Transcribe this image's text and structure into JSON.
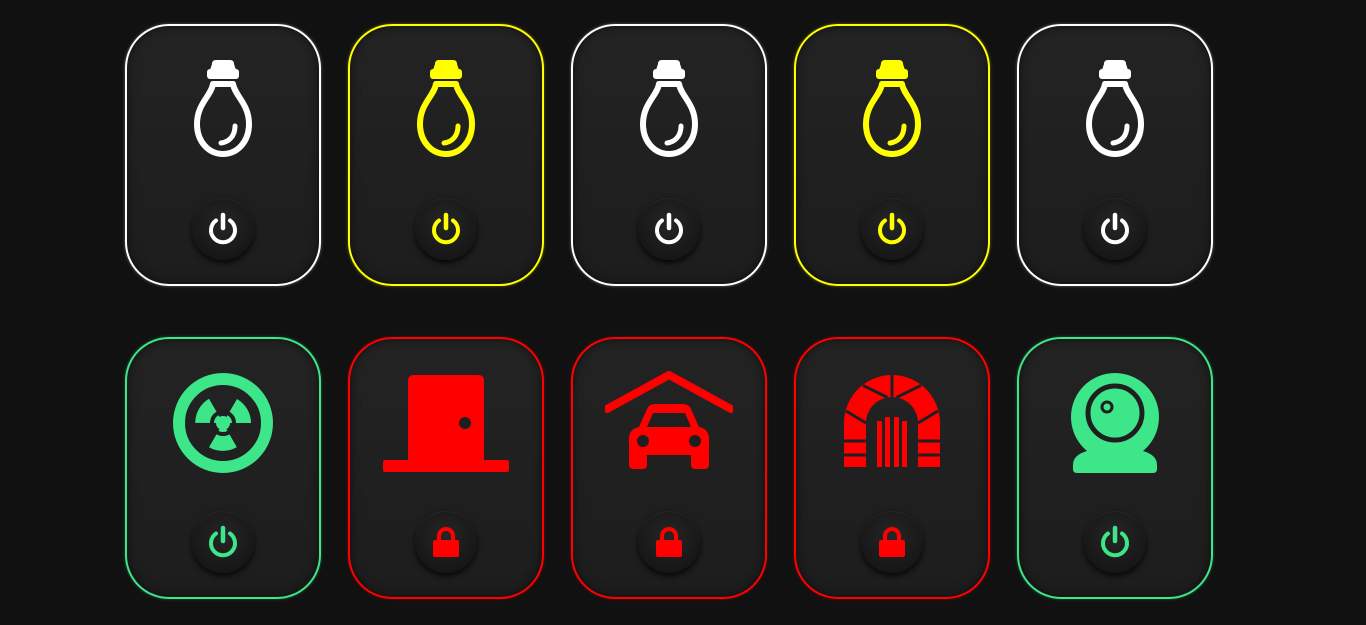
{
  "colors": {
    "white": "#ffffff",
    "yellow": "#ffff00",
    "green": "#3ee68a",
    "red": "#ff0000",
    "background": "#111111"
  },
  "devices": [
    {
      "icon": "bulb-icon",
      "control": "power-icon",
      "state": "off",
      "color": "#ffffff"
    },
    {
      "icon": "bulb-icon",
      "control": "power-icon",
      "state": "on",
      "color": "#ffff00"
    },
    {
      "icon": "bulb-icon",
      "control": "power-icon",
      "state": "off",
      "color": "#ffffff"
    },
    {
      "icon": "bulb-icon",
      "control": "power-icon",
      "state": "on",
      "color": "#ffff00"
    },
    {
      "icon": "bulb-icon",
      "control": "power-icon",
      "state": "off",
      "color": "#ffffff"
    },
    {
      "icon": "fan-icon",
      "control": "power-icon",
      "state": "on",
      "color": "#3ee68a"
    },
    {
      "icon": "door-icon",
      "control": "lock-icon",
      "state": "locked",
      "color": "#ff0000"
    },
    {
      "icon": "garage-icon",
      "control": "lock-icon",
      "state": "locked",
      "color": "#ff0000"
    },
    {
      "icon": "gate-icon",
      "control": "lock-icon",
      "state": "locked",
      "color": "#ff0000"
    },
    {
      "icon": "webcam-icon",
      "control": "power-icon",
      "state": "on",
      "color": "#3ee68a"
    }
  ]
}
